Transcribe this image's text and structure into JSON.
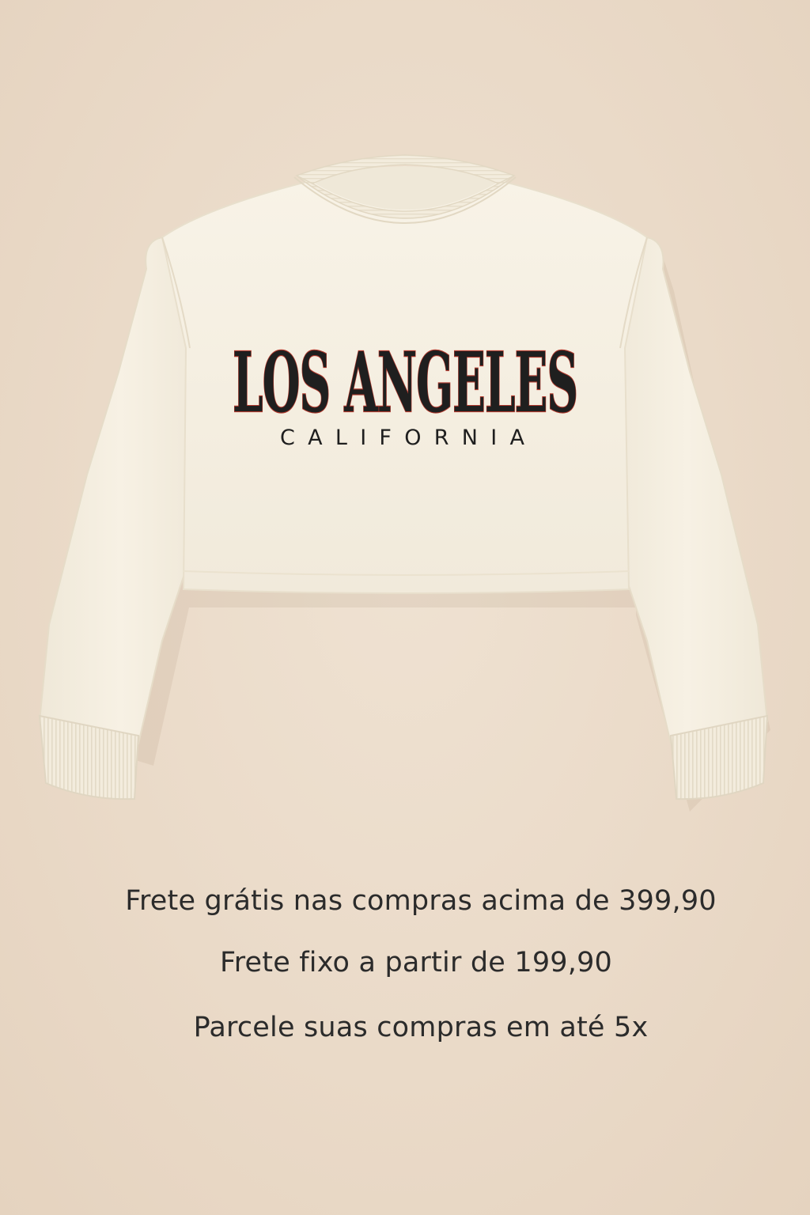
{
  "product": {
    "print_main": "LOS ANGELES",
    "print_sub": "CALIFORNIA",
    "garment_color": "#f6f0e2",
    "background_color": "#ecdccb"
  },
  "info": {
    "free_shipping": "Frete grátis nas compras acima de 399,90",
    "fixed_shipping": "Frete fixo a partir de 199,90",
    "installments": "Parcele suas compras em até 5x"
  }
}
